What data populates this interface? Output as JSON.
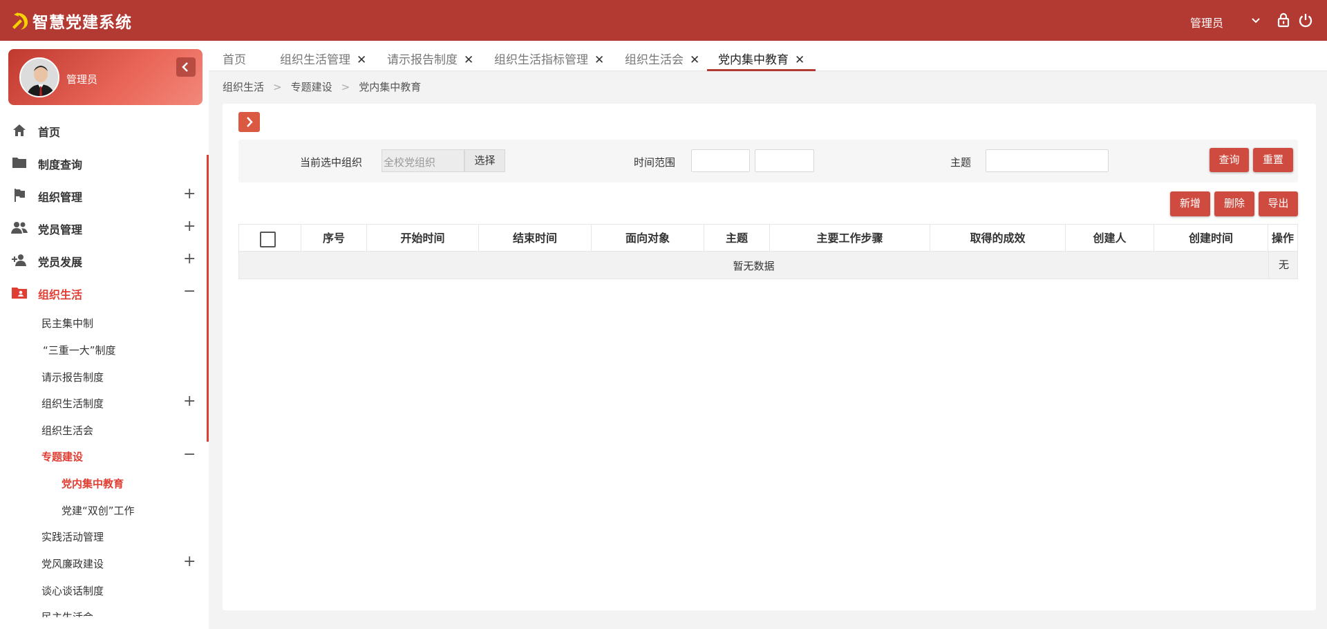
{
  "header": {
    "title": "智慧党建系统",
    "user": "管理员"
  },
  "sidebar": {
    "profile_name": "管理员",
    "menu": [
      {
        "label": "首页"
      },
      {
        "label": "制度查询"
      },
      {
        "label": "组织管理",
        "toggle": "+"
      },
      {
        "label": "党员管理",
        "toggle": "+"
      },
      {
        "label": "党员发展",
        "toggle": "+"
      },
      {
        "label": "组织生活",
        "toggle": "−"
      }
    ],
    "sub": [
      {
        "label": "民主集中制"
      },
      {
        "label": "“三重一大”制度"
      },
      {
        "label": "请示报告制度"
      },
      {
        "label": "组织生活制度",
        "toggle": "+"
      },
      {
        "label": "组织生活会"
      },
      {
        "label": "专题建设",
        "toggle": "−"
      },
      {
        "label": "党内集中教育"
      },
      {
        "label": "党建“双创”工作"
      },
      {
        "label": "实践活动管理"
      },
      {
        "label": "党风廉政建设",
        "toggle": "+"
      },
      {
        "label": "谈心谈话制度"
      },
      {
        "label": "民主生活会"
      }
    ]
  },
  "tabs": [
    {
      "label": "首页"
    },
    {
      "label": "组织生活管理",
      "close": "✕"
    },
    {
      "label": "请示报告制度",
      "close": "✕"
    },
    {
      "label": "组织生活指标管理",
      "close": "✕"
    },
    {
      "label": "组织生活会",
      "close": "✕"
    },
    {
      "label": "党内集中教育",
      "close": "✕"
    }
  ],
  "breadcrumb": {
    "items": [
      "组织生活",
      "专题建设",
      "党内集中教育"
    ],
    "separator": ">"
  },
  "filter": {
    "org_label": "当前选中组织",
    "org_value": "全校党组织",
    "org_button": "选择",
    "time_label": "时间范围",
    "theme_label": "主题",
    "query": "查询",
    "reset": "重置"
  },
  "actions": {
    "add": "新增",
    "delete": "删除",
    "export": "导出"
  },
  "table": {
    "columns": [
      "序号",
      "开始时间",
      "结束时间",
      "面向对象",
      "主题",
      "主要工作步骤",
      "取得的成效",
      "创建人",
      "创建时间",
      "操作"
    ],
    "empty_text": "暂无数据",
    "empty_op": "无"
  },
  "colors": {
    "brand": "#b33a32",
    "accent": "#e03e33",
    "button": "#cf4b3f"
  }
}
